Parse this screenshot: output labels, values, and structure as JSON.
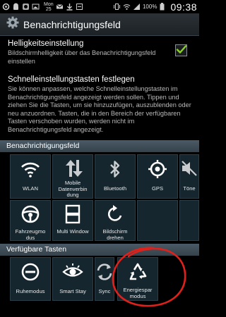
{
  "status_bar": {
    "date_day": "Mon",
    "date_num": "25",
    "battery_percent": "100%",
    "time": "09:38"
  },
  "header": {
    "title": "Benachrichtigungsfeld"
  },
  "brightness_setting": {
    "title": "Helligkeitseinstellung",
    "description": "Bildschirmhelligkeit über das Benachrichtigungsfeld einstellen",
    "checked": true
  },
  "shortcut_setting": {
    "title": "Schnelleinstellungstasten festlegen",
    "description": "Sie können anpassen, welche Schnelleinstellungstasten im Benachrichtigungsfeld angezeigt werden sollen. Tippen und ziehen Sie die Tasten, um sie hinzuzufügen, auszublenden oder neu anzuordnen. Tasten, die in den Bereich der verfügbaren Tasten verschoben wurden, werden nicht im Benachrichtigungsfeld angezeigt."
  },
  "notification_panel": {
    "header": "Benachrichtigungsfeld",
    "tiles": [
      {
        "label": "WLAN",
        "icon": "wifi-icon"
      },
      {
        "label": "Mobile Datenverbin dung",
        "icon": "mobile-data-icon"
      },
      {
        "label": "Bluetooth",
        "icon": "bluetooth-icon"
      },
      {
        "label": "GPS",
        "icon": "gps-icon"
      },
      {
        "label": "Töne",
        "icon": "sound-off-icon"
      },
      {
        "label": "Fahrzeugmo dus",
        "icon": "steering-wheel-icon"
      },
      {
        "label": "Multi Window",
        "icon": "multi-window-icon"
      },
      {
        "label": "Bildschirm drehen",
        "icon": "rotate-icon"
      }
    ]
  },
  "available_buttons": {
    "header": "Verfügbare Tasten",
    "tiles": [
      {
        "label": "Ruhemodus",
        "icon": "blocking-mode-icon"
      },
      {
        "label": "Smart Stay",
        "icon": "smart-stay-eye-icon"
      },
      {
        "label": "Sync",
        "icon": "sync-icon"
      },
      {
        "label": "Energiespar modus",
        "icon": "recycle-icon"
      }
    ]
  },
  "colors": {
    "check_green": "#8ad21e",
    "annotation_red": "#e0211b"
  }
}
